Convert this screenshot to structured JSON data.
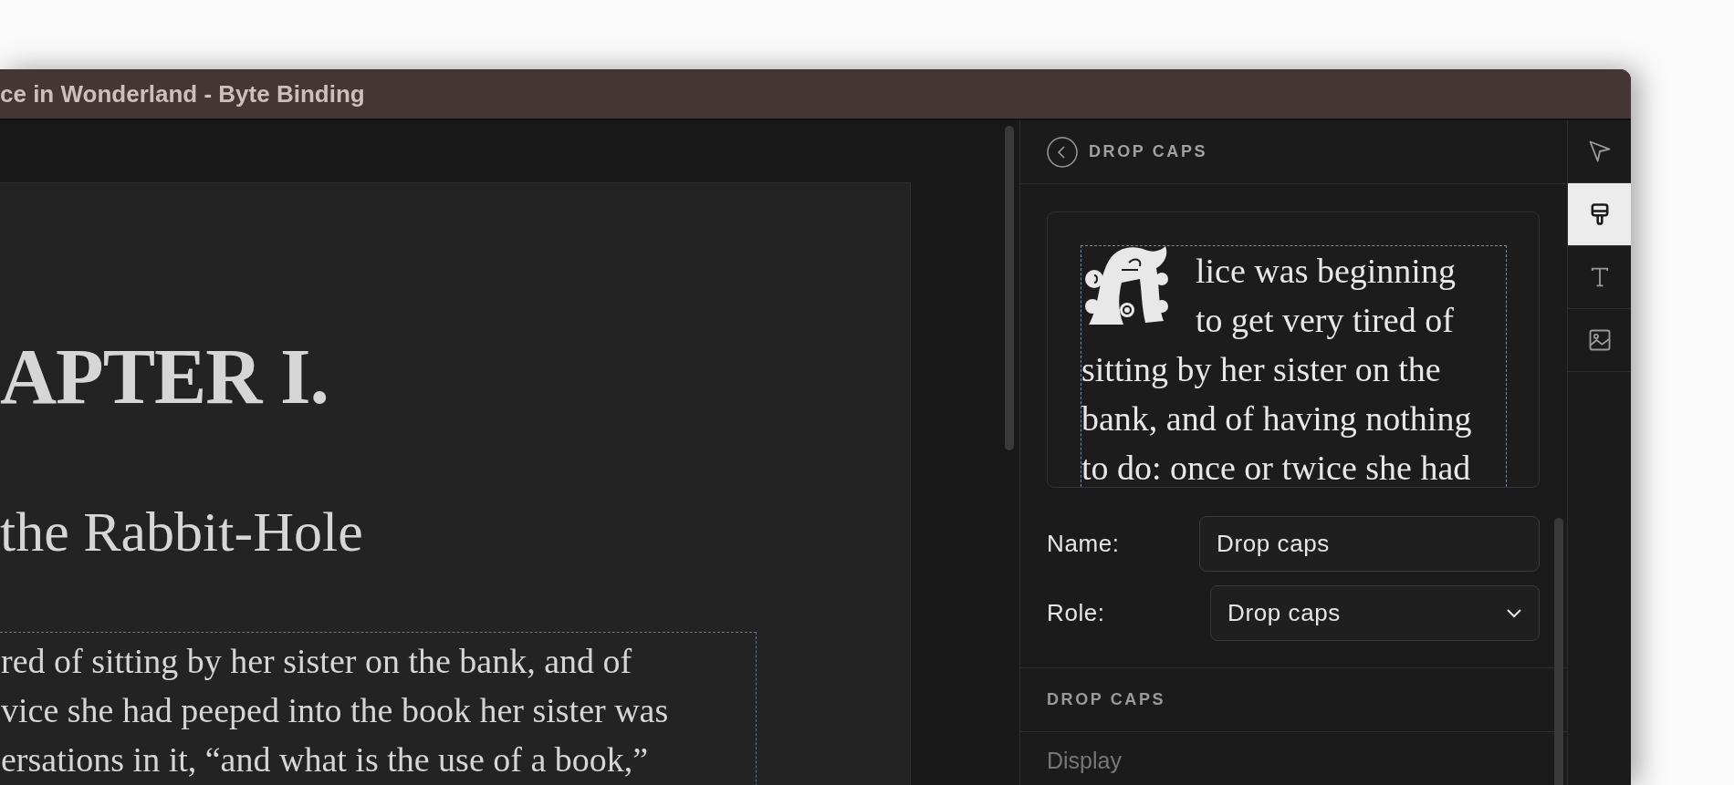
{
  "window": {
    "title": "ce in Wonderland - Byte Binding"
  },
  "page": {
    "chapter_heading": "APTER I.",
    "chapter_subtitle": "the Rabbit-Hole",
    "paragraph_lines": [
      "red of sitting by her sister on the bank, and of",
      "vice she had peeped into the book her sister was",
      "ersations in it, “and what is the use of a book,”"
    ]
  },
  "panel": {
    "title": "DROP CAPS",
    "preview_lines": [
      "lice was beginning",
      "to get very tired of",
      "sitting by her sister on the",
      "bank, and of having nothing",
      "to do: once or twice she had"
    ],
    "fields": [
      {
        "kind": "text",
        "label": "Name:",
        "value": "Drop caps"
      },
      {
        "kind": "select",
        "label": "Role:",
        "value": "Drop caps"
      }
    ],
    "section_title": "DROP CAPS",
    "rows": [
      "Display"
    ]
  },
  "tool_rail": [
    {
      "kind": "pointer",
      "selected": false
    },
    {
      "kind": "brush",
      "selected": true
    },
    {
      "kind": "text",
      "selected": false
    },
    {
      "kind": "image",
      "selected": false
    }
  ]
}
